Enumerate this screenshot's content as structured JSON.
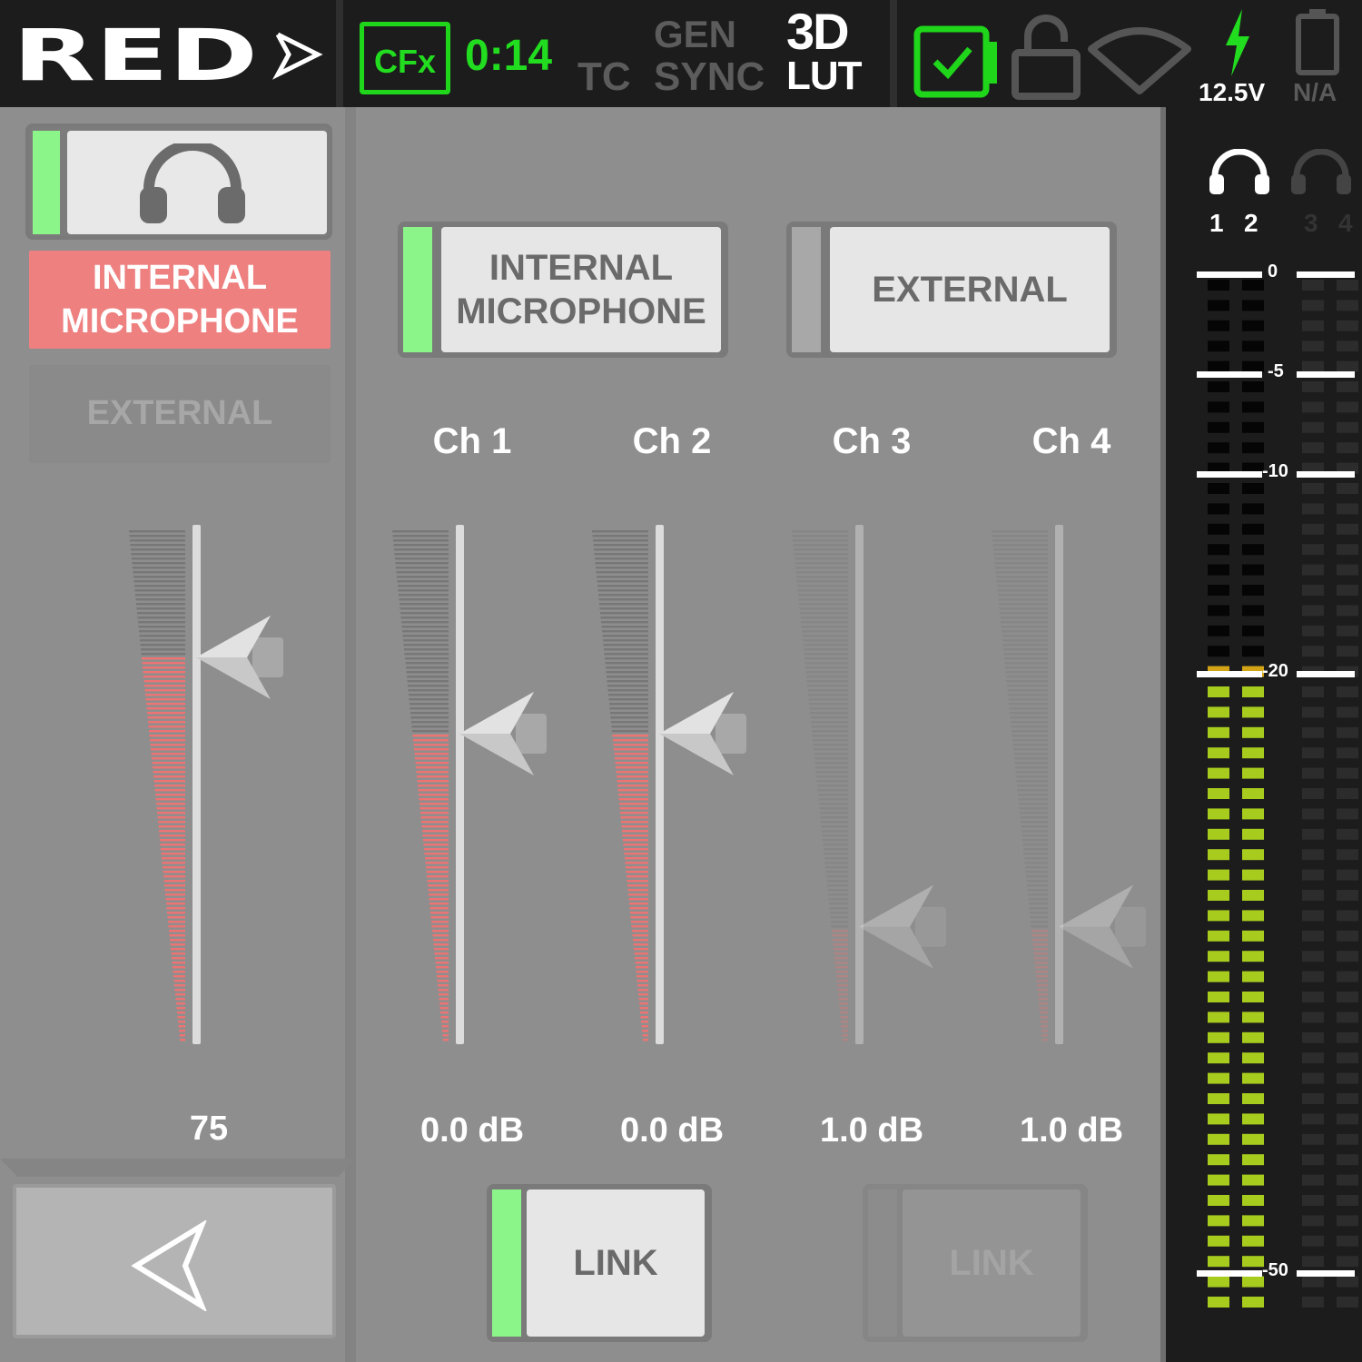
{
  "topbar": {
    "brand": "RED",
    "media_label": "CFx",
    "record_time": "0:14",
    "tc_label": "TC",
    "gen_label": "GEN",
    "sync_label": "SYNC",
    "lut_top": "3D",
    "lut_bottom": "LUT",
    "voltage": "12.5V",
    "battery_status": "N/A",
    "colors": {
      "active_green": "#22dd1f",
      "inactive": "#5a5a5a"
    }
  },
  "left": {
    "monitor_icon": "headphones-icon",
    "sources": [
      {
        "label": "INTERNAL\nMICROPHONE",
        "selected": true
      },
      {
        "label": "EXTERNAL",
        "selected": false
      }
    ],
    "headphone_level": {
      "value": 75,
      "display": "75"
    },
    "back_icon": "back-arrow-icon"
  },
  "middle": {
    "input_sources": [
      {
        "label": "INTERNAL\nMICROPHONE",
        "selected": true
      },
      {
        "label": "EXTERNAL",
        "selected": false
      }
    ],
    "channels": [
      {
        "name": "Ch 1",
        "gain": "0.0 dB",
        "enabled": true
      },
      {
        "name": "Ch 2",
        "gain": "0.0 dB",
        "enabled": true
      },
      {
        "name": "Ch 3",
        "gain": "1.0 dB",
        "enabled": false
      },
      {
        "name": "Ch 4",
        "gain": "1.0 dB",
        "enabled": false
      }
    ],
    "link_buttons": [
      {
        "label": "LINK",
        "active": true
      },
      {
        "label": "LINK",
        "active": false
      }
    ]
  },
  "meter": {
    "monitor_icons": [
      "headphones-icon",
      "headphones-icon"
    ],
    "channel_labels": [
      "1",
      "2",
      "3",
      "4"
    ],
    "db_scale": [
      "0",
      "-5",
      "-10",
      "-20",
      "-50"
    ],
    "levels_db": [
      -19,
      -19,
      null,
      null
    ],
    "colors": {
      "normal": "#a8cc1e",
      "warn": "#d4a417",
      "off": "#050505",
      "off_inactive": "#2c2c2c"
    }
  }
}
